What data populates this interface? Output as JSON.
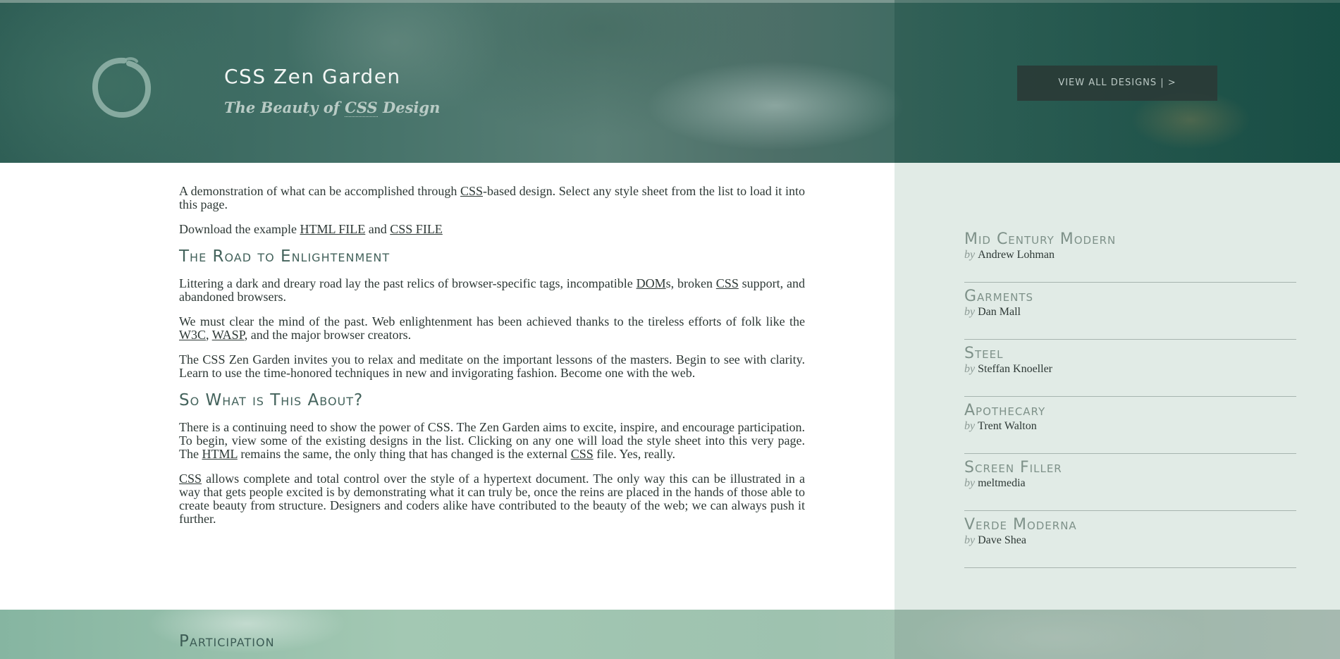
{
  "header": {
    "title": "CSS Zen Garden",
    "subtitle_pre": "The Beauty of ",
    "subtitle_abbr": "CSS",
    "subtitle_post": " Design",
    "view_all_label": "VIEW ALL DESIGNS | >",
    "logo_icon": "enso-circle-icon"
  },
  "intro": {
    "p1_a": "A demonstration of what can be accomplished through ",
    "p1_link": "CSS",
    "p1_b": "-based design. Select any style sheet from the list to load it into this page.",
    "p2_a": "Download the example ",
    "p2_link1": "HTML FILE",
    "p2_b": " and ",
    "p2_link2": "CSS FILE"
  },
  "enlightenment": {
    "heading": "The Road to Enlightenment",
    "p1_a": "Littering a dark and dreary road lay the past relics of browser-specific tags, incompatible ",
    "p1_link1": "DOM",
    "p1_b": "s, broken ",
    "p1_link2": "CSS",
    "p1_c": " support, and abandoned browsers.",
    "p2_a": "We must clear the mind of the past. Web enlightenment has been achieved thanks to the tireless efforts of folk like the ",
    "p2_link1": "W3C",
    "p2_b": ", ",
    "p2_link2": "WASP",
    "p2_c": ", and the major browser creators.",
    "p3": "The CSS Zen Garden invites you to relax and meditate on the important lessons of the masters. Begin to see with clarity. Learn to use the time-honored techniques in new and invigorating fashion. Become one with the web."
  },
  "about": {
    "heading": "So What is This About?",
    "p1_a": "There is a continuing need to show the power of CSS. The Zen Garden aims to excite, inspire, and encourage participation. To begin, view some of the existing designs in the list. Clicking on any one will load the style sheet into this very page. The ",
    "p1_link1": "HTML",
    "p1_b": " remains the same, the only thing that has changed is the external ",
    "p1_link2": "CSS",
    "p1_c": " file. Yes, really.",
    "p2_link": "CSS",
    "p2_a": " allows complete and total control over the style of a hypertext document. The only way this can be illustrated in a way that gets people excited is by demonstrating what it can truly be, once the reins are placed in the hands of those able to create beauty from structure. Designers and coders alike have contributed to the beauty of the web; we can always push it further."
  },
  "designs": [
    {
      "name": "Mid Century Modern",
      "by": "by",
      "author": "Andrew Lohman"
    },
    {
      "name": "Garments",
      "by": "by",
      "author": "Dan Mall"
    },
    {
      "name": "Steel",
      "by": "by",
      "author": "Steffan Knoeller"
    },
    {
      "name": "Apothecary",
      "by": "by",
      "author": "Trent Walton"
    },
    {
      "name": "Screen Filler",
      "by": "by",
      "author": "meltmedia"
    },
    {
      "name": "Verde Moderna",
      "by": "by",
      "author": "Dave Shea"
    }
  ],
  "participation": {
    "heading": "Participation"
  }
}
